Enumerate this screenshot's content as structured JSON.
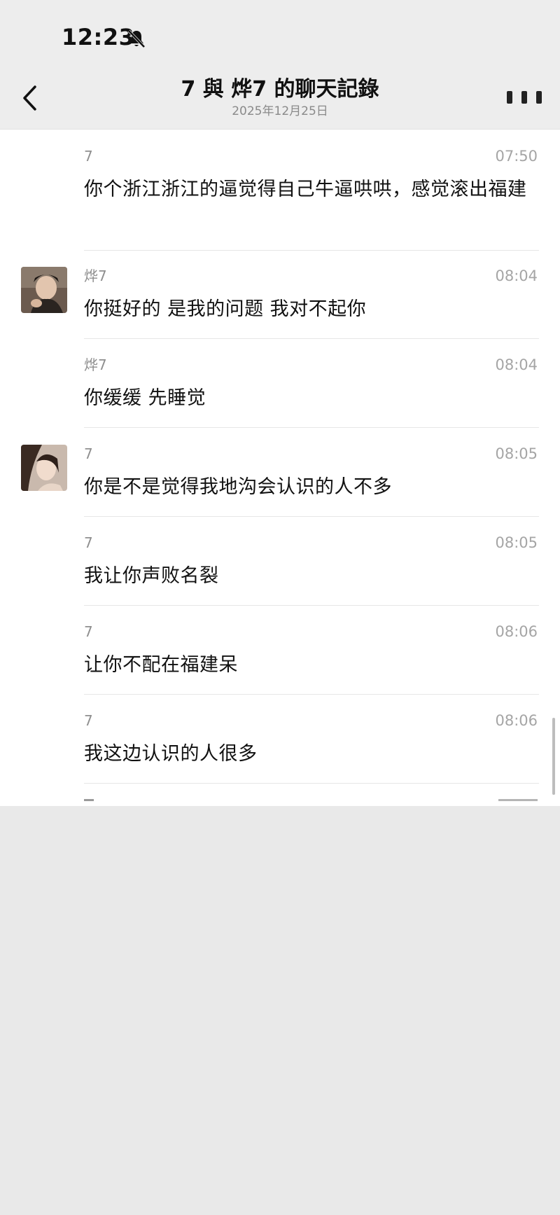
{
  "status_bar": {
    "time": "12:23",
    "icon": "bell-slash-icon"
  },
  "header": {
    "title": "7 與 烨7 的聊天記錄",
    "date": "2025年12月25日",
    "back_icon": "chevron-left-icon",
    "more_icon": "more-icon"
  },
  "messages": [
    {
      "sender": "7",
      "time": "07:50",
      "text": "你个浙江浙江的逼觉得自己牛逼哄哄，感觉滚出福建",
      "avatar": false
    },
    {
      "sender": "烨7",
      "time": "08:04",
      "text": "你挺好的 是我的问题 我对不起你",
      "avatar": true
    },
    {
      "sender": "烨7",
      "time": "08:04",
      "text": "你缓缓 先睡觉",
      "avatar": false
    },
    {
      "sender": "7",
      "time": "08:05",
      "text": "你是不是觉得我地沟会认识的人不多",
      "avatar": true
    },
    {
      "sender": "7",
      "time": "08:05",
      "text": "我让你声败名裂",
      "avatar": false
    },
    {
      "sender": "7",
      "time": "08:06",
      "text": "让你不配在福建呆",
      "avatar": false
    },
    {
      "sender": "7",
      "time": "08:06",
      "text": "我这边认识的人很多",
      "avatar": false
    }
  ],
  "colors": {
    "background": "#e9e9e9",
    "header": "#ededed",
    "list": "#ffffff",
    "separator": "#e6e6e6",
    "meta_text": "#8f8f8f"
  }
}
